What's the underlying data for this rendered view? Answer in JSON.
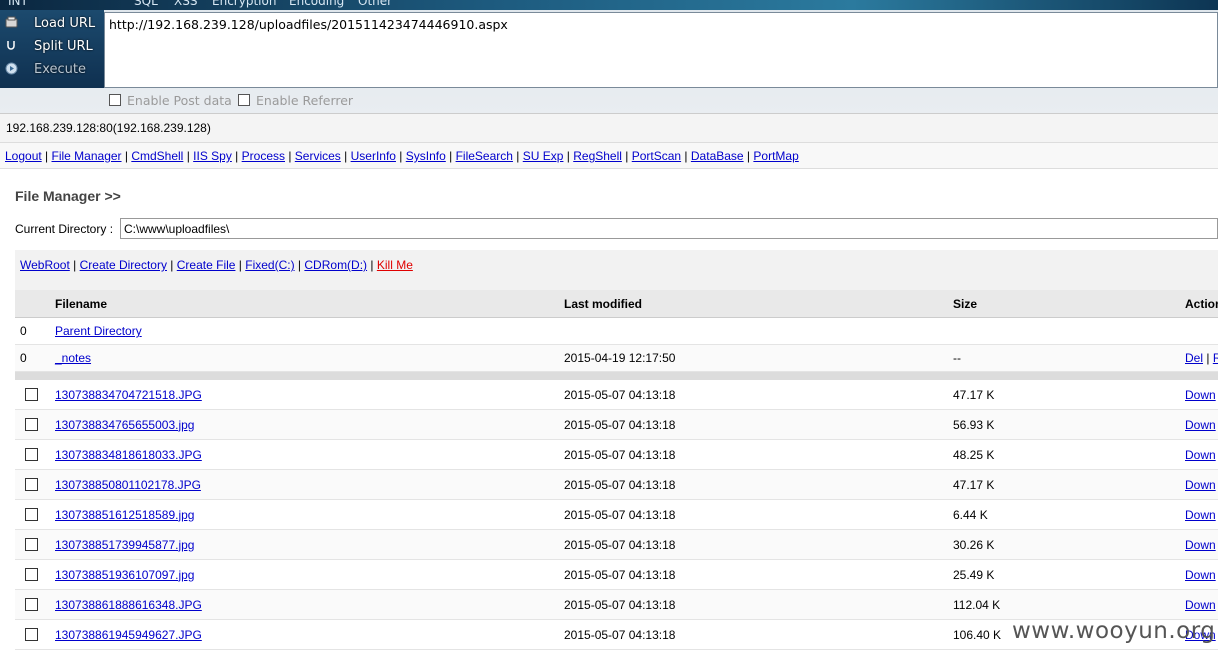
{
  "hackbar": {
    "menus": [
      "INT",
      "SQL",
      "XSS",
      "Encryption",
      "Encoding",
      "Other"
    ],
    "load_url": "Load URL",
    "split_url": "Split URL",
    "execute": "Execute",
    "url": "http://192.168.239.128/uploadfiles/201511423474446910.aspx",
    "enable_post": "Enable Post data",
    "enable_referrer": "Enable Referrer"
  },
  "host": "192.168.239.128:80(192.168.239.128)",
  "nav": [
    "Logout",
    "File Manager",
    "CmdShell",
    "IIS Spy",
    "Process",
    "Services",
    "UserInfo",
    "SysInfo",
    "FileSearch",
    "SU Exp",
    "RegShell",
    "PortScan",
    "DataBase",
    "PortMap"
  ],
  "file_manager": {
    "title": "File Manager >>",
    "current_dir_label": "Current Directory :",
    "current_dir": "C:\\www\\uploadfiles\\",
    "actions": [
      "WebRoot",
      "Create Directory",
      "Create File",
      "Fixed(C:)",
      "CDRom(D:)"
    ],
    "kill": "Kill Me",
    "headers": {
      "filename": "Filename",
      "modified": "Last modified",
      "size": "Size",
      "action": "Action"
    },
    "parent": {
      "num": "0",
      "name": "Parent Directory"
    },
    "notes": {
      "num": "0",
      "name": "_notes",
      "modified": "2015-04-19 12:17:50",
      "size": "--",
      "del": "Del",
      "more": "R"
    },
    "files": [
      {
        "name": "130738834704721518.JPG",
        "modified": "2015-05-07 04:13:18",
        "size": "47.17 K",
        "action": "Down"
      },
      {
        "name": "130738834765655003.jpg",
        "modified": "2015-05-07 04:13:18",
        "size": "56.93 K",
        "action": "Down"
      },
      {
        "name": "130738834818618033.JPG",
        "modified": "2015-05-07 04:13:18",
        "size": "48.25 K",
        "action": "Down"
      },
      {
        "name": "130738850801102178.JPG",
        "modified": "2015-05-07 04:13:18",
        "size": "47.17 K",
        "action": "Down"
      },
      {
        "name": "130738851612518589.jpg",
        "modified": "2015-05-07 04:13:18",
        "size": "6.44 K",
        "action": "Down"
      },
      {
        "name": "130738851739945877.jpg",
        "modified": "2015-05-07 04:13:18",
        "size": "30.26 K",
        "action": "Down"
      },
      {
        "name": "130738851936107097.jpg",
        "modified": "2015-05-07 04:13:18",
        "size": "25.49 K",
        "action": "Down"
      },
      {
        "name": "130738861888616348.JPG",
        "modified": "2015-05-07 04:13:18",
        "size": "112.04 K",
        "action": "Down"
      },
      {
        "name": "130738861945949627.JPG",
        "modified": "2015-05-07 04:13:18",
        "size": "106.40 K",
        "action": "Down"
      }
    ]
  },
  "watermark": "www.wooyun.org"
}
